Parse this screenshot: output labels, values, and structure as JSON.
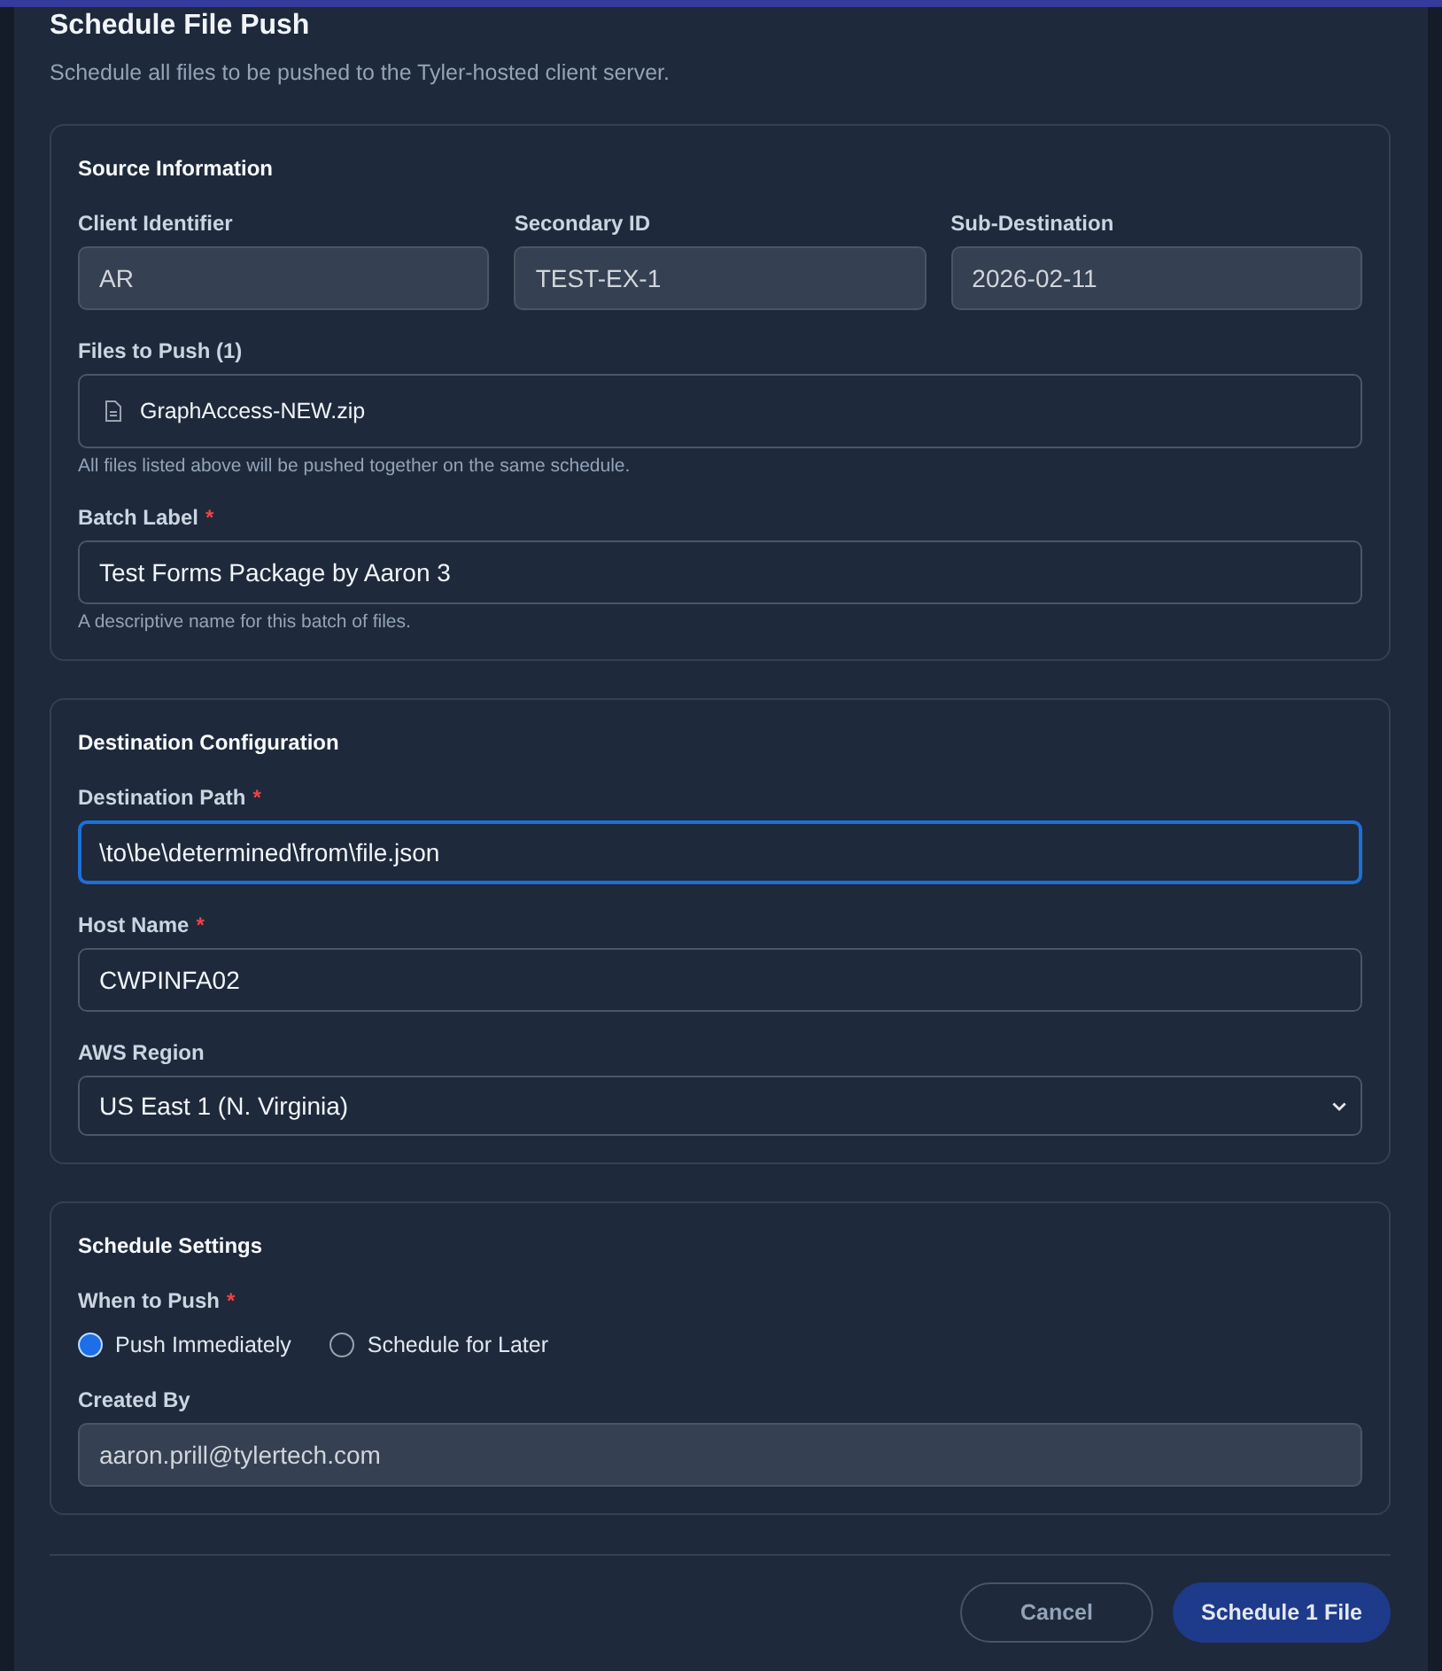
{
  "dialog": {
    "title": "Schedule File Push",
    "subtitle": "Schedule all files to be pushed to the Tyler-hosted client server."
  },
  "sections": [
    {
      "title": "Source Information",
      "fields": [
        {
          "kind": "row",
          "fields": [
            {
              "kind": "text",
              "label": "Client Identifier",
              "value": "AR",
              "disabled": true,
              "focused": false
            },
            {
              "kind": "text",
              "label": "Secondary ID",
              "value": "TEST-EX-1",
              "disabled": true,
              "focused": false
            },
            {
              "kind": "text",
              "label": "Sub-Destination",
              "value": "2026-02-11",
              "disabled": true,
              "focused": false
            }
          ]
        },
        {
          "kind": "files",
          "label": "Files to Push (1)",
          "files": [
            {
              "name": "GraphAccess-NEW.zip"
            }
          ],
          "hint": "All files listed above will be pushed together on the same schedule."
        },
        {
          "kind": "text",
          "label": "Batch Label",
          "required_mark": "*",
          "value": "Test Forms Package by Aaron 3",
          "disabled": false,
          "focused": false,
          "hint": "A descriptive name for this batch of files."
        }
      ]
    },
    {
      "title": "Destination Configuration",
      "fields": [
        {
          "kind": "text",
          "label": "Destination Path",
          "required_mark": "*",
          "value": "\\to\\be\\determined\\from\\file.json",
          "disabled": false,
          "focused": true
        },
        {
          "kind": "text",
          "label": "Host Name",
          "required_mark": "*",
          "value": "CWPINFA02",
          "disabled": false,
          "focused": false
        },
        {
          "kind": "select",
          "label": "AWS Region",
          "value": "US East 1 (N. Virginia)"
        }
      ]
    },
    {
      "title": "Schedule Settings",
      "fields": [
        {
          "kind": "radio",
          "label": "When to Push",
          "required_mark": "*",
          "options": [
            {
              "label": "Push Immediately",
              "selected": true
            },
            {
              "label": "Schedule for Later",
              "selected": false
            }
          ]
        },
        {
          "kind": "text",
          "label": "Created By",
          "value": "aaron.prill@tylertech.com",
          "disabled": true,
          "focused": false
        }
      ]
    }
  ],
  "buttons": [
    {
      "label": "Cancel",
      "kind": "secondary"
    },
    {
      "label": "Schedule 1 File",
      "kind": "primary"
    }
  ]
}
